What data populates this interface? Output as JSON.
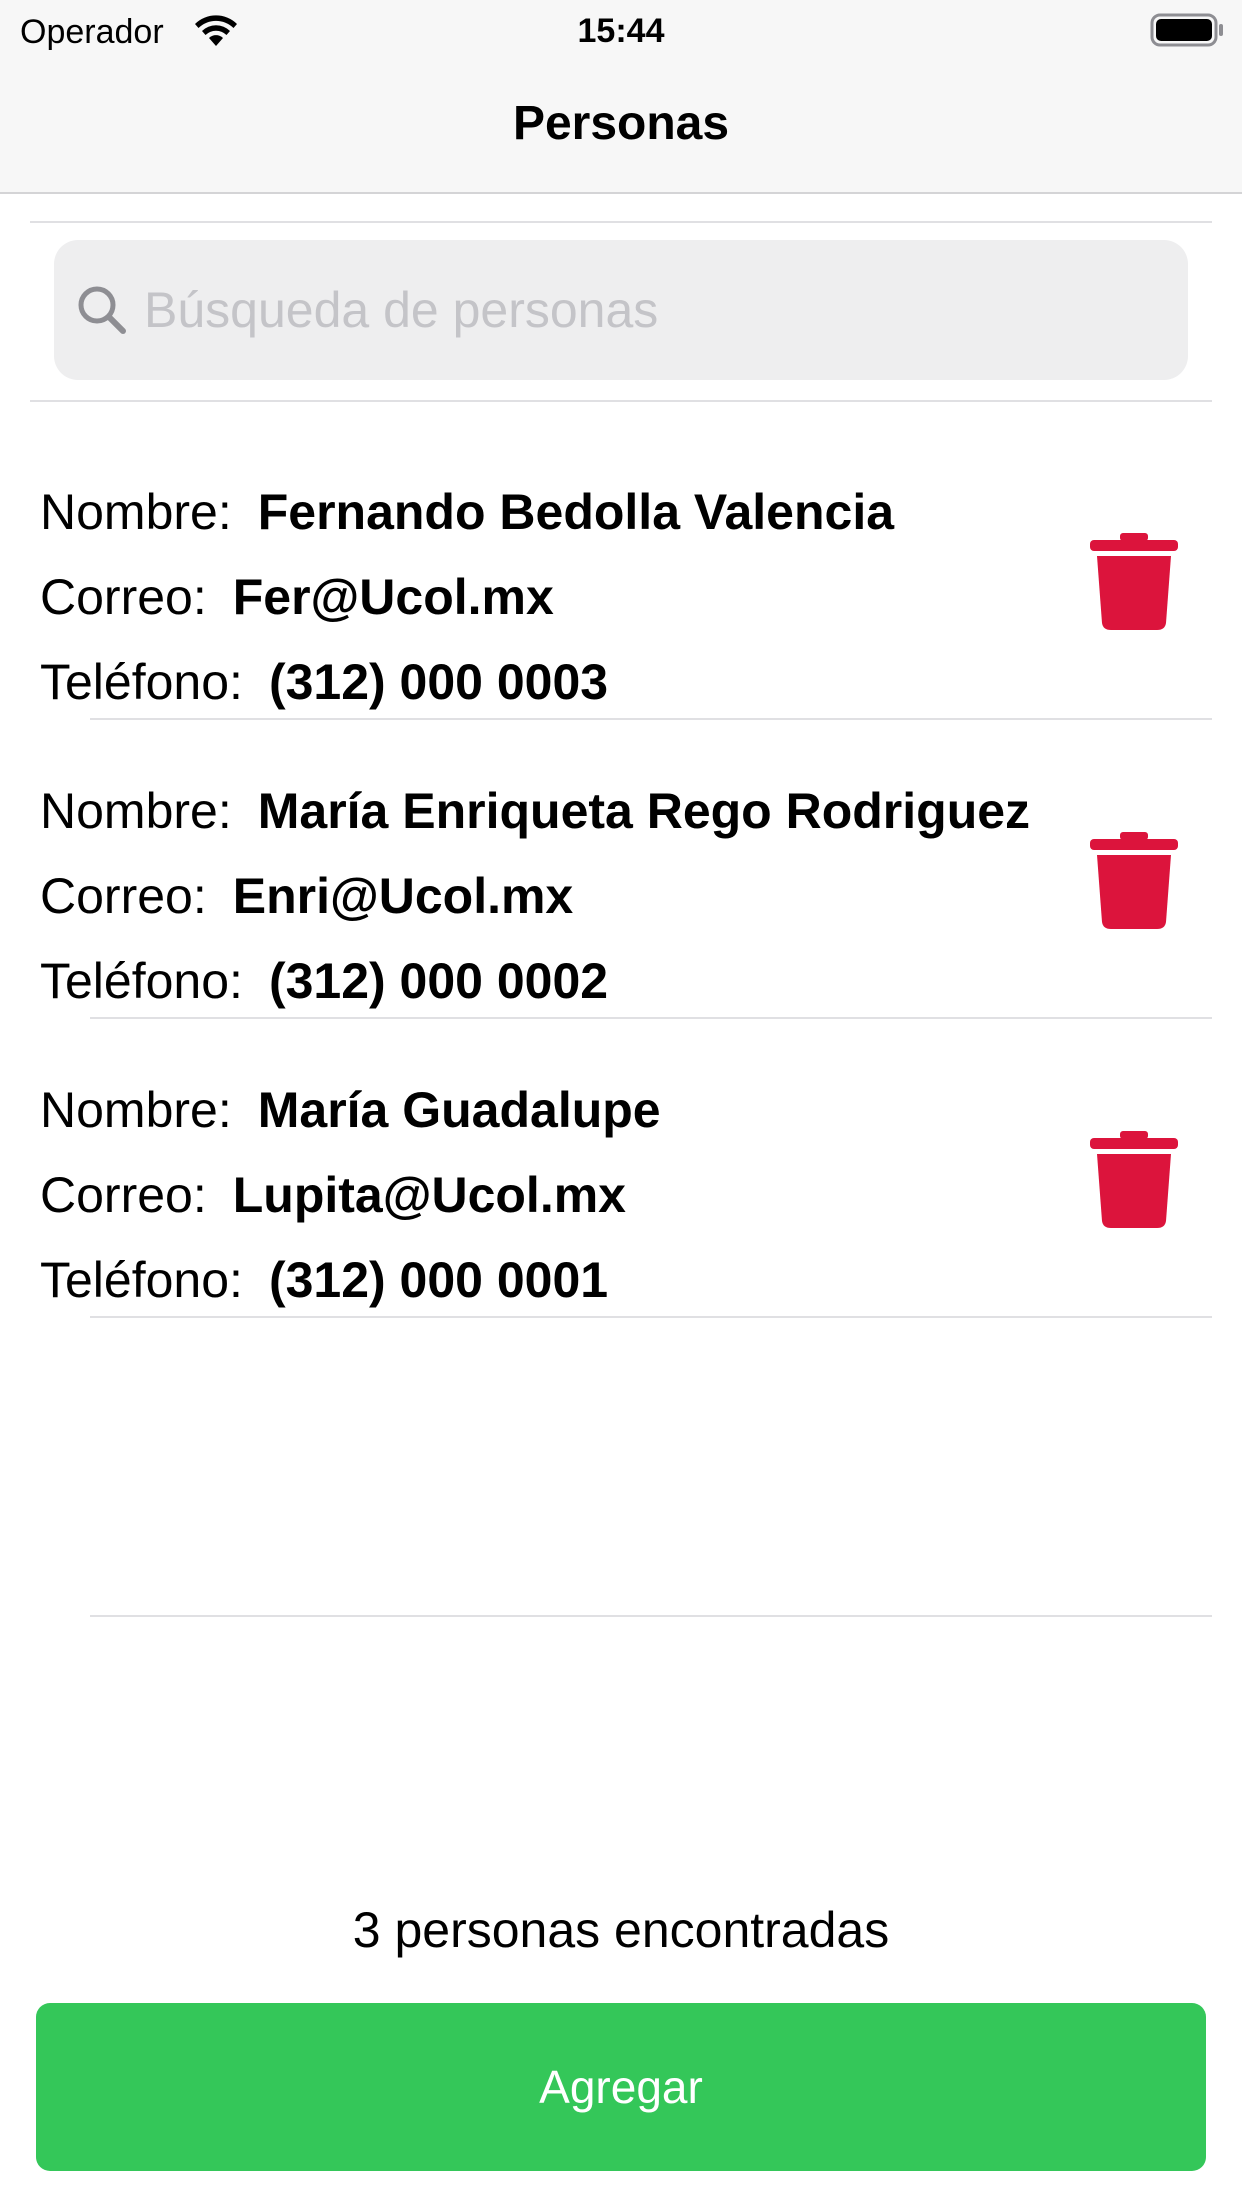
{
  "status_bar": {
    "carrier": "Operador",
    "time": "15:44",
    "wifi_icon": "wifi-icon",
    "battery_icon": "battery-full-icon"
  },
  "nav": {
    "title": "Personas"
  },
  "search": {
    "placeholder": "Búsqueda de personas",
    "value": "",
    "icon": "search-icon"
  },
  "labels": {
    "name": "Nombre:",
    "email": "Correo:",
    "phone": "Teléfono:"
  },
  "people": [
    {
      "name": "Fernando Bedolla Valencia",
      "email": "Fer@Ucol.mx",
      "phone": "(312) 000 0003"
    },
    {
      "name": "María Enriqueta Rego Rodriguez",
      "email": "Enri@Ucol.mx",
      "phone": "(312) 000 0002"
    },
    {
      "name": "María Guadalupe",
      "email": "Lupita@Ucol.mx",
      "phone": "(312) 000 0001"
    }
  ],
  "footer": {
    "count_text": "3 personas encontradas",
    "add_label": "Agregar"
  },
  "colors": {
    "delete": "#dc143c",
    "add_button": "#34c759",
    "placeholder": "#c4c4c8"
  }
}
